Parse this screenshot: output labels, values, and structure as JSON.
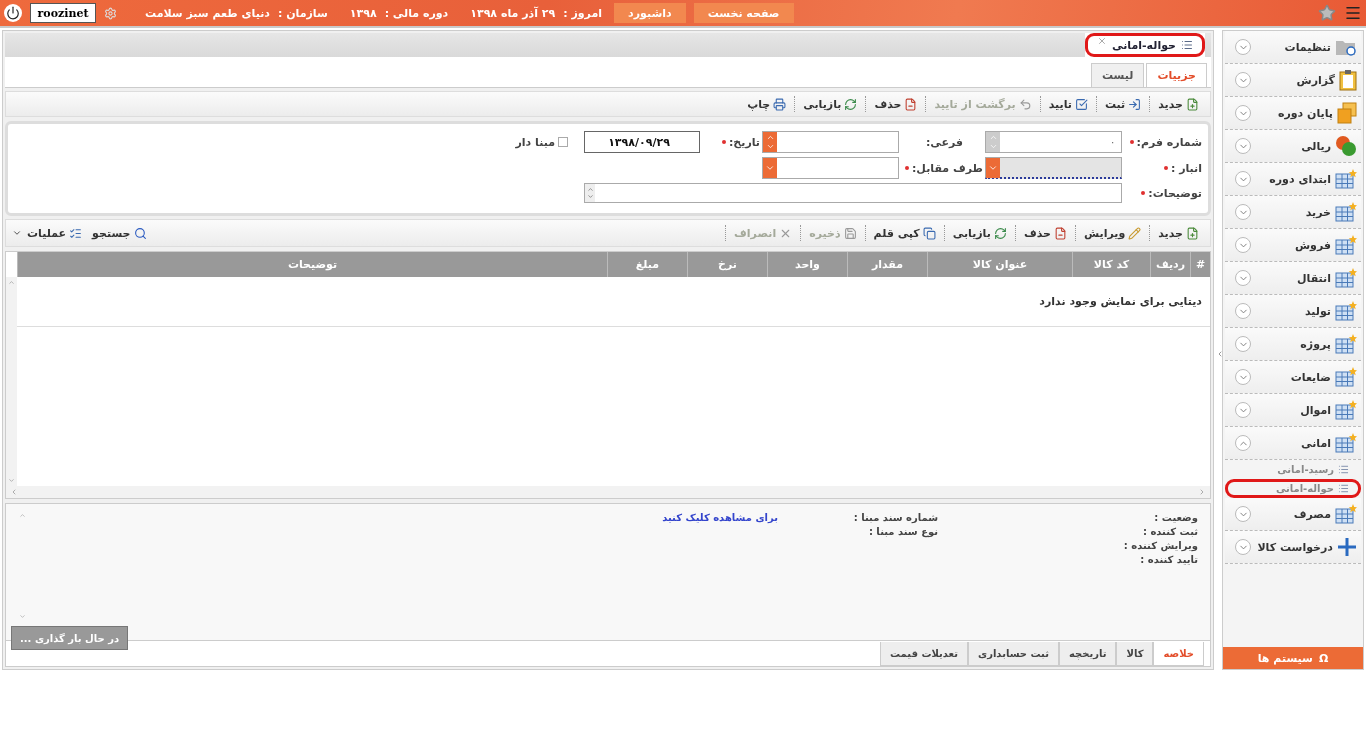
{
  "top_bar": {
    "buttons": [
      {
        "label": "صفحه نخست"
      },
      {
        "label": "داشبورد"
      }
    ],
    "infos": [
      {
        "label": "امروز :",
        "value": "۲۹ آذر ماه ۱۳۹۸"
      },
      {
        "label": "دوره مالی :",
        "value": "۱۳۹۸"
      },
      {
        "label": "سازمان :",
        "value": "دنیای طعم سبز سلامت"
      }
    ],
    "user": "roozinet"
  },
  "document_tabs": [
    {
      "label": "حواله-امانی",
      "selected": true,
      "highlighted": true
    }
  ],
  "view_tabs": [
    {
      "label": "جزییات",
      "selected": true
    },
    {
      "label": "لیست",
      "selected": false
    }
  ],
  "main_toolbar": [
    {
      "kind": "new",
      "label": "جدید",
      "disabled": false
    },
    {
      "kind": "register",
      "label": "ثبت",
      "disabled": false
    },
    {
      "kind": "confirm",
      "label": "تایید",
      "disabled": false
    },
    {
      "kind": "revert",
      "label": "برگشت از تایید",
      "disabled": true
    },
    {
      "kind": "delete",
      "label": "حذف",
      "disabled": false
    },
    {
      "kind": "restore",
      "label": "بازیابی",
      "disabled": false
    },
    {
      "kind": "print",
      "label": "چاپ",
      "disabled": false
    }
  ],
  "form": {
    "form_number": {
      "label": "شماره فرم:",
      "required": true,
      "value": "۰",
      "disabled": true
    },
    "sub": {
      "label": "فرعی:",
      "required": false,
      "disabled": false
    },
    "date": {
      "label": "تاریخ:",
      "required": true,
      "value": "۱۳۹۸/۰۹/۲۹"
    },
    "based": {
      "label": "مبنا دار",
      "checked": false
    },
    "warehouse": {
      "label": "انبار :",
      "required": true,
      "focused": true
    },
    "counterparty": {
      "label": "طرف مقابل:",
      "required": true,
      "focused": false
    },
    "description": {
      "label": "توضیحات:",
      "required": true
    }
  },
  "items_toolbar": [
    {
      "kind": "new",
      "label": "جدید",
      "disabled": false
    },
    {
      "kind": "edit",
      "label": "ویرایش",
      "disabled": false
    },
    {
      "kind": "delete",
      "label": "حذف",
      "disabled": false
    },
    {
      "kind": "restore",
      "label": "بازیابی",
      "disabled": false
    },
    {
      "kind": "copy",
      "label": "کپی قلم",
      "disabled": false
    },
    {
      "kind": "save",
      "label": "ذخیره",
      "disabled": true
    },
    {
      "kind": "cancel",
      "label": "انصراف",
      "disabled": true
    }
  ],
  "items_toolbar_left": [
    {
      "kind": "search",
      "label": "جستجو"
    },
    {
      "kind": "operations",
      "label": "عملیات"
    }
  ],
  "table": {
    "columns": [
      "#",
      "ردیف",
      "کد کالا",
      "عنوان کالا",
      "مقدار",
      "واحد",
      "نرخ",
      "مبلغ",
      "توضیحات"
    ],
    "empty_message": "دیتایی برای نمایش وجود ندارد"
  },
  "summary": {
    "fields": [
      "وضعیت :",
      "ثبت کننده :",
      "ویرایش کننده :",
      "تایید کننده :"
    ],
    "source_fields": [
      "شماره سند مبنا :",
      "نوع سند مبنا :"
    ],
    "link": "برای مشاهده کلیک کنید",
    "loading": "در حال بار گذاری ...",
    "tabs": [
      {
        "label": "خلاصه",
        "selected": true
      },
      {
        "label": "کالا",
        "selected": false
      },
      {
        "label": "تاریخچه",
        "selected": false
      },
      {
        "label": "ثبت حسابداری",
        "selected": false
      },
      {
        "label": "تعدیلات قیمت",
        "selected": false
      }
    ]
  },
  "sidebar": {
    "items": [
      {
        "kind": "folder",
        "label": "تنظیمات",
        "expanded": false
      },
      {
        "kind": "report",
        "label": "گزارش",
        "expanded": false
      },
      {
        "kind": "stack",
        "label": "پایان دوره",
        "expanded": false
      },
      {
        "kind": "coins",
        "label": "ریالی",
        "expanded": false
      },
      {
        "kind": "table",
        "label": "ابتدای دوره",
        "expanded": false
      },
      {
        "kind": "table",
        "label": "خرید",
        "expanded": false
      },
      {
        "kind": "table",
        "label": "فروش",
        "expanded": false
      },
      {
        "kind": "table",
        "label": "انتقال",
        "expanded": false
      },
      {
        "kind": "table",
        "label": "تولید",
        "expanded": false
      },
      {
        "kind": "table",
        "label": "پروژه",
        "expanded": false
      },
      {
        "kind": "table",
        "label": "ضایعات",
        "expanded": false
      },
      {
        "kind": "table",
        "label": "اموال",
        "expanded": false
      },
      {
        "kind": "table",
        "label": "امانی",
        "expanded": true,
        "children": [
          {
            "label": "رسید-امانی",
            "highlighted": false
          },
          {
            "label": "حواله-امانی",
            "highlighted": true
          }
        ]
      },
      {
        "kind": "table",
        "label": "مصرف",
        "expanded": false
      },
      {
        "kind": "plus",
        "label": "درخواست کالا",
        "expanded": false
      }
    ],
    "systems_button": {
      "icon": "Ω",
      "label": "سیستم ها"
    }
  }
}
